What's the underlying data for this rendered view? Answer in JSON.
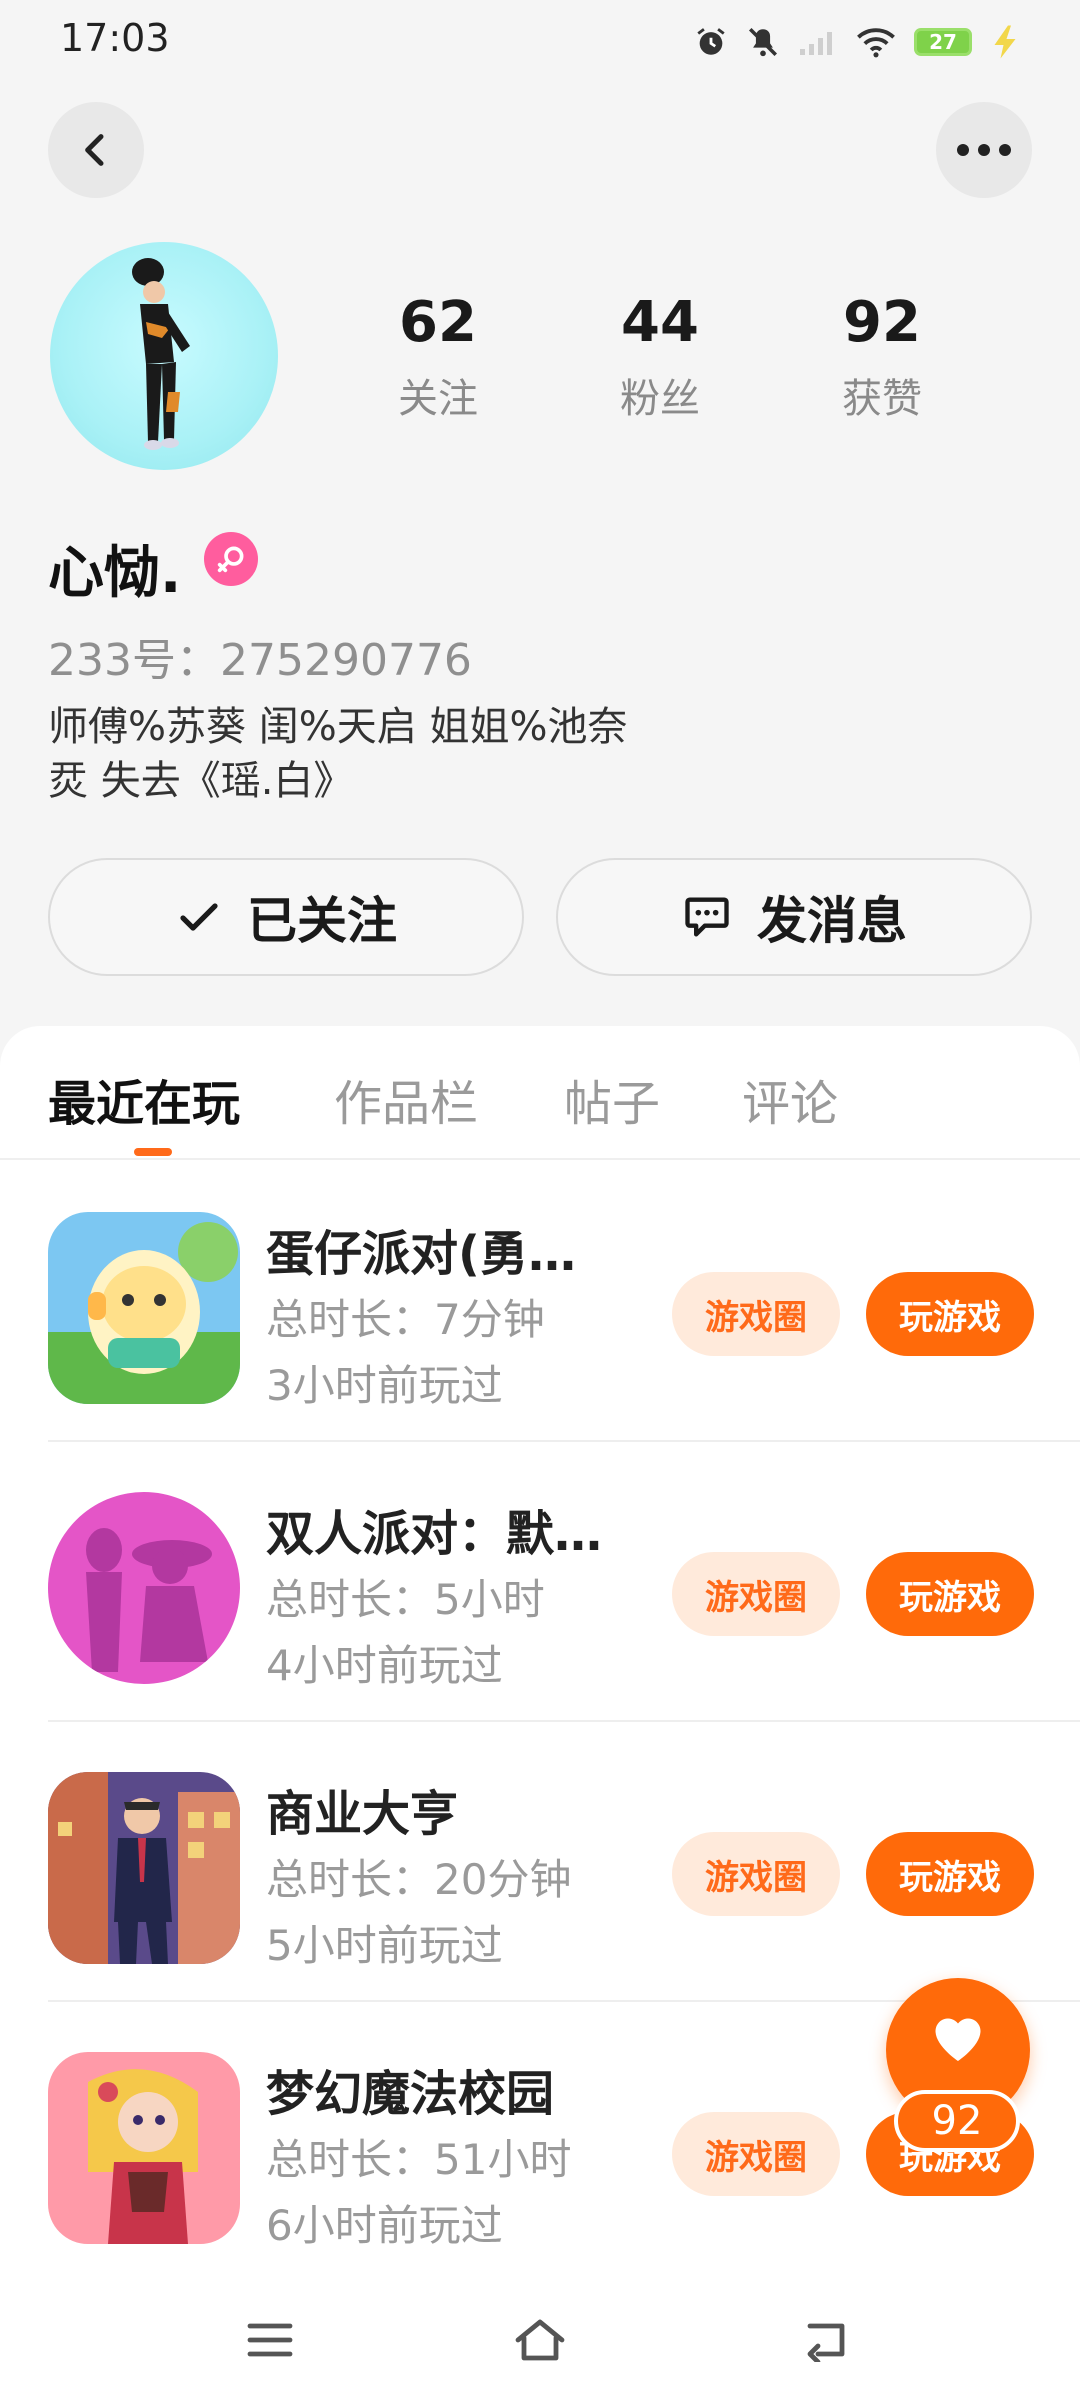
{
  "status_bar": {
    "time": "17:03",
    "battery": "27"
  },
  "profile": {
    "username": "心恸.",
    "account_id": "233号：275290776",
    "bio": "师傅%苏葵  闺%天启  姐姐%池奈\n烎  失去《瑶.白》",
    "stats": [
      {
        "value": "62",
        "label": "关注"
      },
      {
        "value": "44",
        "label": "粉丝"
      },
      {
        "value": "92",
        "label": "获赞"
      }
    ]
  },
  "actions": {
    "followed_label": "已关注",
    "message_label": "发消息"
  },
  "tabs": [
    {
      "label": "最近在玩",
      "active": true
    },
    {
      "label": "作品栏",
      "active": false
    },
    {
      "label": "帖子",
      "active": false
    },
    {
      "label": "评论",
      "active": false
    }
  ],
  "games": [
    {
      "name": "蛋仔派对(勇…",
      "duration": "总时长：7分钟",
      "last_played": "3小时前玩过",
      "circle_label": "游戏圈",
      "play_label": "玩游戏"
    },
    {
      "name": "双人派对：默…",
      "duration": "总时长：5小时",
      "last_played": "4小时前玩过",
      "circle_label": "游戏圈",
      "play_label": "玩游戏"
    },
    {
      "name": "商业大亨",
      "duration": "总时长：20分钟",
      "last_played": "5小时前玩过",
      "circle_label": "游戏圈",
      "play_label": "玩游戏"
    },
    {
      "name": "梦幻魔法校园",
      "duration": "总时长：51小时",
      "last_played": "6小时前玩过",
      "circle_label": "游戏圈",
      "play_label": "玩游戏"
    }
  ],
  "floating_like": {
    "count": "92"
  },
  "colors": {
    "accent": "#ff6a0a",
    "accent_light": "#ffeadb",
    "gender": "#ff5d9e"
  },
  "icons": [
    "alarm-icon",
    "mute-icon",
    "signal-icon",
    "wifi-icon",
    "battery-icon",
    "charging-icon",
    "back-icon",
    "more-icon",
    "check-icon",
    "chat-icon",
    "female-icon",
    "heart-icon",
    "menu-icon",
    "home-icon",
    "back-nav-icon"
  ]
}
